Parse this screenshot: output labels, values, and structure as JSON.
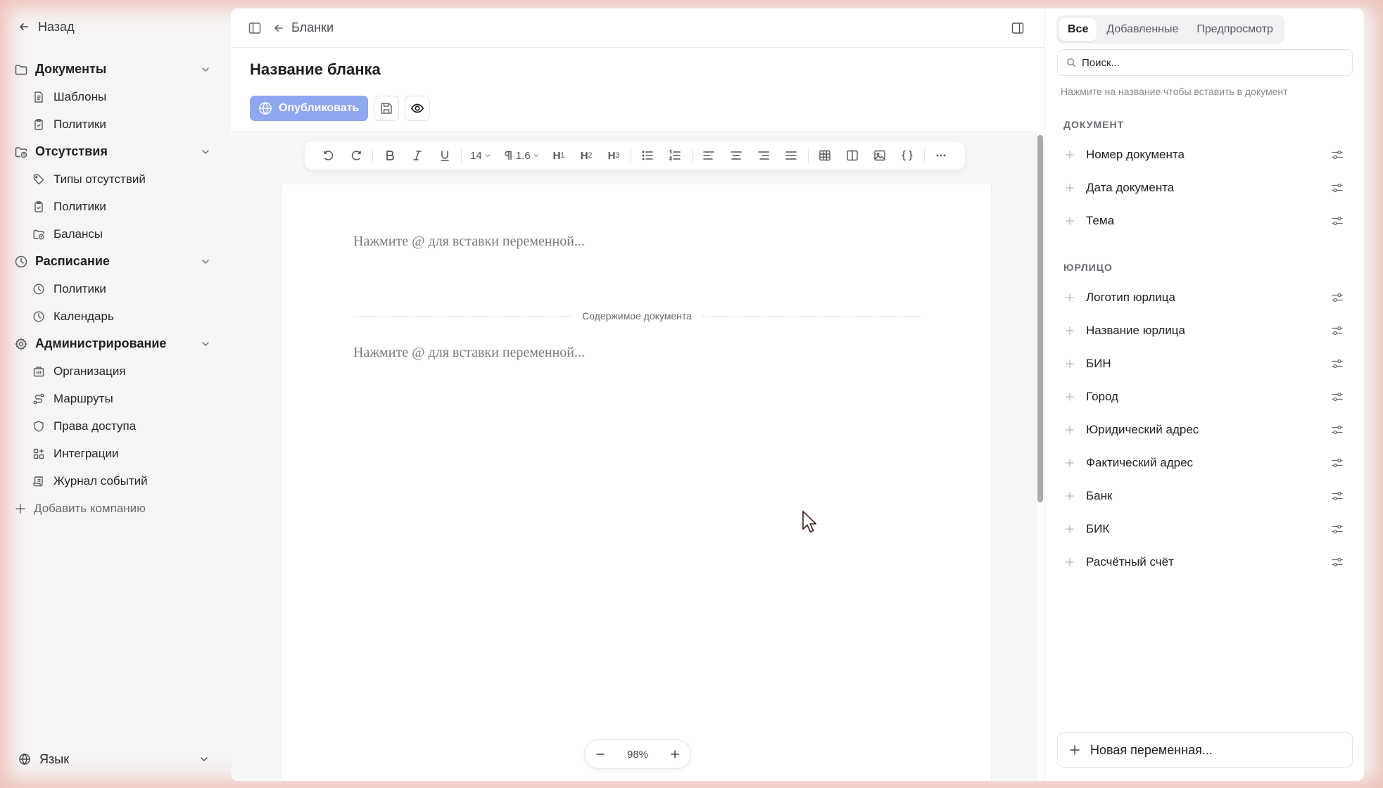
{
  "sidebar": {
    "back_label": "Назад",
    "groups": [
      {
        "label": "Документы",
        "icon": "folder-icon",
        "items": [
          {
            "label": "Шаблоны",
            "icon": "file-text-icon"
          },
          {
            "label": "Политики",
            "icon": "clipboard-check-icon"
          }
        ]
      },
      {
        "label": "Отсутствия",
        "icon": "folder-clock-icon",
        "items": [
          {
            "label": "Типы отсутствий",
            "icon": "tag-icon"
          },
          {
            "label": "Политики",
            "icon": "clipboard-check-icon"
          },
          {
            "label": "Балансы",
            "icon": "folder-clock-icon"
          }
        ]
      },
      {
        "label": "Расписание",
        "icon": "clock-icon",
        "items": [
          {
            "label": "Политики",
            "icon": "clock-icon"
          },
          {
            "label": "Календарь",
            "icon": "clock-icon"
          }
        ]
      },
      {
        "label": "Администрирование",
        "icon": "gear-icon",
        "items": [
          {
            "label": "Организация",
            "icon": "building-icon"
          },
          {
            "label": "Маршруты",
            "icon": "route-icon"
          },
          {
            "label": "Права доступа",
            "icon": "shield-icon"
          },
          {
            "label": "Интеграции",
            "icon": "grid-plus-icon"
          },
          {
            "label": "Журнал событий",
            "icon": "scroll-icon"
          }
        ]
      }
    ],
    "add_company_label": "Добавить компанию",
    "language_label": "Язык"
  },
  "main": {
    "breadcrumb": "Бланки",
    "title": "Название бланка",
    "publish_label": "Опубликовать",
    "toolbar": {
      "font_size": "14",
      "line_height": "1.6",
      "h1": "H",
      "h1_sub": "1",
      "h2": "H",
      "h2_sub": "2",
      "h3": "H",
      "h3_sub": "3"
    },
    "header_placeholder": "Нажмите @ для вставки переменной...",
    "content_divider": "Содержимое документа",
    "footer_placeholder": "Нажмите @ для вставки переменной...",
    "zoom_value": "98%"
  },
  "right_panel": {
    "tabs": [
      {
        "label": "Все",
        "active": true
      },
      {
        "label": "Добавленные",
        "active": false
      },
      {
        "label": "Предпросмотр",
        "active": false
      }
    ],
    "search_placeholder": "Поиск...",
    "hint": "Нажмите на название чтобы вставить в документ",
    "sections": [
      {
        "title": "ДОКУМЕНТ",
        "items": [
          "Номер документа",
          "Дата документа",
          "Тема"
        ]
      },
      {
        "title": "ЮРЛИЦО",
        "items": [
          "Логотип юрлица",
          "Название юрлица",
          "БИН",
          "Город",
          "Юридический адрес",
          "Фактический адрес",
          "Банк",
          "БИК",
          "Расчётный счёт"
        ]
      }
    ],
    "new_variable_label": "Новая переменная...",
    "colors": {
      "publish_button": "#8fa6f0",
      "frame_glow": "#e89687"
    }
  }
}
